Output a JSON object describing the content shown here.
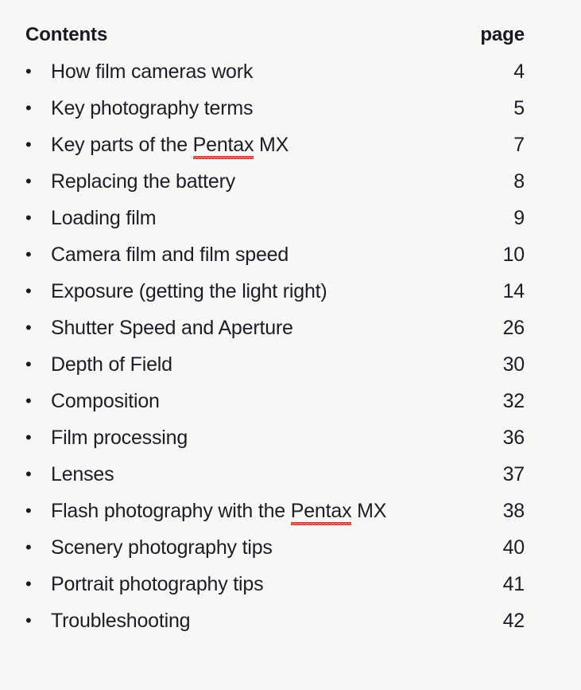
{
  "document": {
    "background_color": "#f7f7f6",
    "text_color": "#1d1d27",
    "heading_color": "#191922",
    "spellcheck_underline_color": "#c0392b"
  },
  "header": {
    "title": "Contents",
    "page_column_label": "page"
  },
  "bullet_glyph": "•",
  "entries": [
    {
      "label": "How film cameras work",
      "page": "4"
    },
    {
      "label": "Key photography terms",
      "page": "5"
    },
    {
      "label_prefix": "Key parts of the ",
      "misspelled": "Pentax",
      "label_suffix": " MX",
      "page": "7"
    },
    {
      "label": "Replacing the battery",
      "page": "8"
    },
    {
      "label": "Loading film",
      "page": "9"
    },
    {
      "label": "Camera film and film speed",
      "page": "10"
    },
    {
      "label": "Exposure (getting the light right)",
      "page": "14"
    },
    {
      "label": "Shutter Speed and Aperture",
      "page": "26"
    },
    {
      "label": "Depth of Field",
      "page": "30"
    },
    {
      "label": "Composition",
      "page": "32"
    },
    {
      "label": "Film processing",
      "page": "36"
    },
    {
      "label": "Lenses",
      "page": "37"
    },
    {
      "label_prefix": "Flash photography with the ",
      "misspelled": "Pentax",
      "label_suffix": " MX",
      "page": "38"
    },
    {
      "label": "Scenery photography tips",
      "page": "40"
    },
    {
      "label": "Portrait photography tips",
      "page": "41"
    },
    {
      "label": "Troubleshooting",
      "page": "42"
    }
  ]
}
